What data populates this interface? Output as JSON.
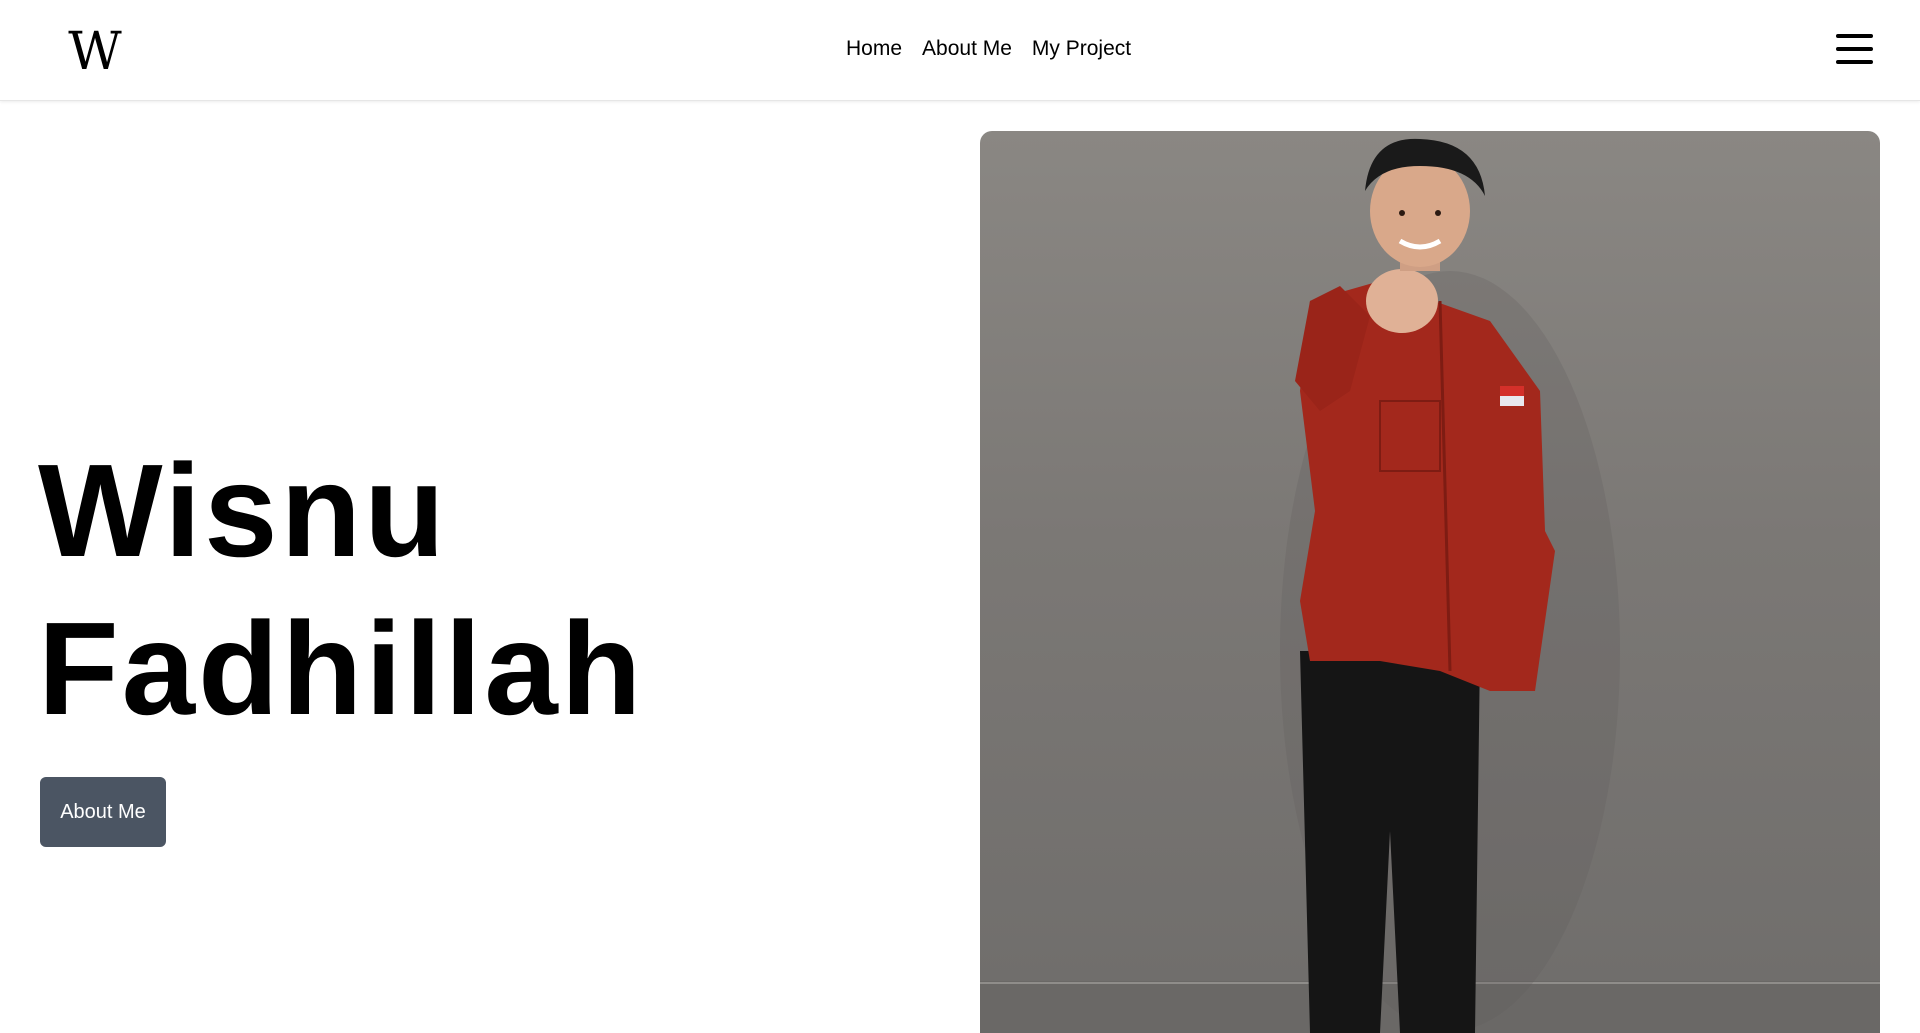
{
  "header": {
    "logo_text": "W",
    "nav": [
      {
        "label": "Home"
      },
      {
        "label": "About Me"
      },
      {
        "label": "My Project"
      }
    ],
    "menu_icon": "hamburger-menu-icon"
  },
  "hero": {
    "title_line1": "Wisnu",
    "title_line2": "Fadhillah",
    "cta_label": "About Me"
  },
  "colors": {
    "cta_bg": "#4b5563",
    "photo_bg": "#7b7875",
    "shirt": "#a3281c",
    "pants": "#151515"
  }
}
